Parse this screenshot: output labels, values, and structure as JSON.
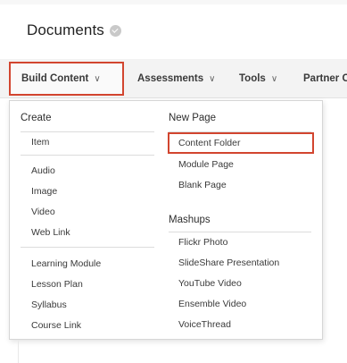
{
  "page": {
    "title": "Documents"
  },
  "toolbar": {
    "build_content": "Build Content",
    "assessments": "Assessments",
    "tools": "Tools",
    "partner": "Partner C",
    "chevron": "∨"
  },
  "menu": {
    "create": {
      "heading": "Create",
      "items": [
        "Item",
        "Audio",
        "Image",
        "Video",
        "Web Link",
        "Learning Module",
        "Lesson Plan",
        "Syllabus",
        "Course Link"
      ]
    },
    "new_page": {
      "heading": "New Page",
      "items": [
        "Content Folder",
        "Module Page",
        "Blank Page"
      ]
    },
    "mashups": {
      "heading": "Mashups",
      "items": [
        "Flickr Photo",
        "SlideShare Presentation",
        "YouTube Video",
        "Ensemble Video",
        "VoiceThread"
      ]
    }
  },
  "colors": {
    "highlight": "#d2452f",
    "toolbar_bg": "#f3f3f3"
  },
  "icons": {
    "title_status": "check-circle-icon",
    "chevron": "chevron-down-icon"
  }
}
